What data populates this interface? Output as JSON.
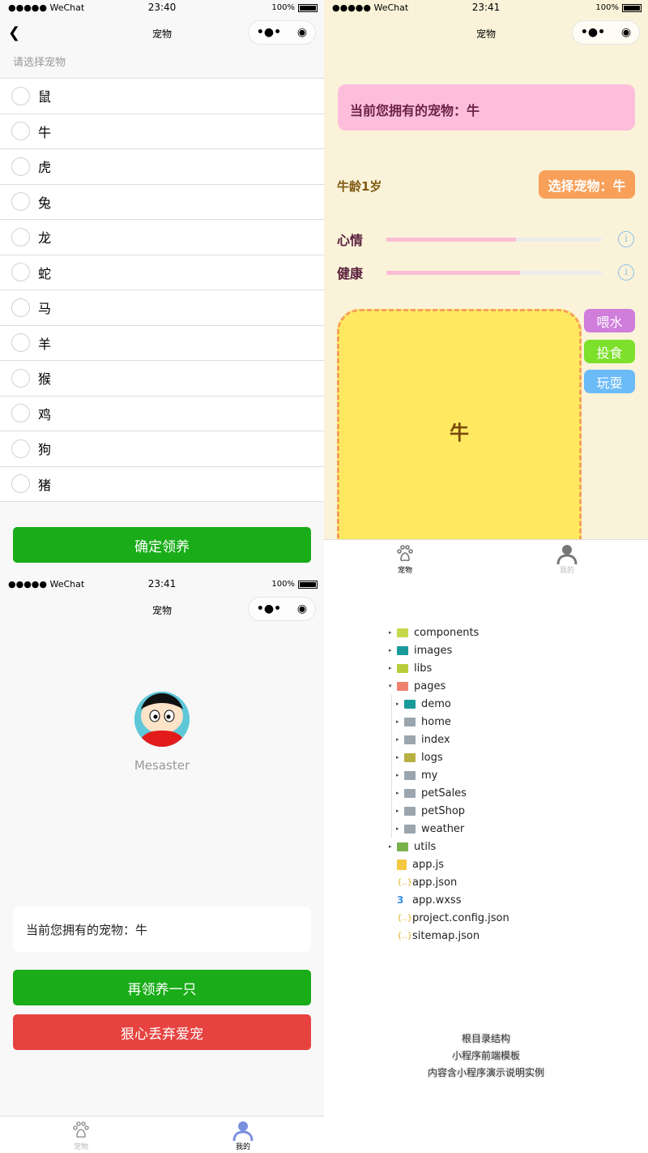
{
  "screen1": {
    "status": {
      "carrier": "●●●●● WeChat",
      "time": "23:40",
      "battery": "100%"
    },
    "nav_title": "宠物",
    "hint": "请选择宠物",
    "options": [
      "鼠",
      "牛",
      "虎",
      "兔",
      "龙",
      "蛇",
      "马",
      "羊",
      "猴",
      "鸡",
      "狗",
      "猪"
    ],
    "confirm_label": "确定领养",
    "accent": "#1aad19"
  },
  "screen2": {
    "status": {
      "carrier": "●●●●● WeChat",
      "time": "23:41",
      "battery": "100%"
    },
    "nav_title": "宠物",
    "owned": "当前您拥有的宠物：牛",
    "age": "牛龄1岁",
    "select_label": "选择宠物：牛",
    "stats": [
      {
        "label": "心情",
        "percent": 60
      },
      {
        "label": "健康",
        "percent": 62
      }
    ],
    "pet_name": "牛",
    "actions": [
      {
        "label": "喂水",
        "color": "#d07ddb"
      },
      {
        "label": "投食",
        "color": "#7de02b"
      },
      {
        "label": "玩耍",
        "color": "#6bbbf7"
      }
    ],
    "tabs": [
      {
        "label": "宠物",
        "icon": "paw-icon",
        "active": true
      },
      {
        "label": "我的",
        "icon": "user-icon",
        "active": false
      }
    ]
  },
  "screen3": {
    "status": {
      "carrier": "●●●●● WeChat",
      "time": "23:41",
      "battery": "100%"
    },
    "nav_title": "宠物",
    "username": "Mesaster",
    "owned": "当前您拥有的宠物：牛",
    "adopt_again": "再领养一只",
    "abandon": "狠心丢弃爱宠",
    "danger": "#e64340",
    "tabs": [
      {
        "label": "宠物",
        "icon": "paw-icon",
        "active": false
      },
      {
        "label": "我的",
        "icon": "user-icon",
        "active": true
      }
    ]
  },
  "filetree": {
    "items": [
      "components",
      "images",
      "libs",
      "pages"
    ],
    "pages_children": [
      "demo",
      "home",
      "index",
      "logs",
      "my",
      "petSales",
      "petShop",
      "weather"
    ],
    "after": [
      "utils"
    ],
    "files": [
      "app.js",
      "app.json",
      "app.wxss",
      "project.config.json",
      "sitemap.json"
    ],
    "caption": [
      "根目录结构",
      "小程序前端模板",
      "内容含小程序演示说明实例"
    ]
  }
}
